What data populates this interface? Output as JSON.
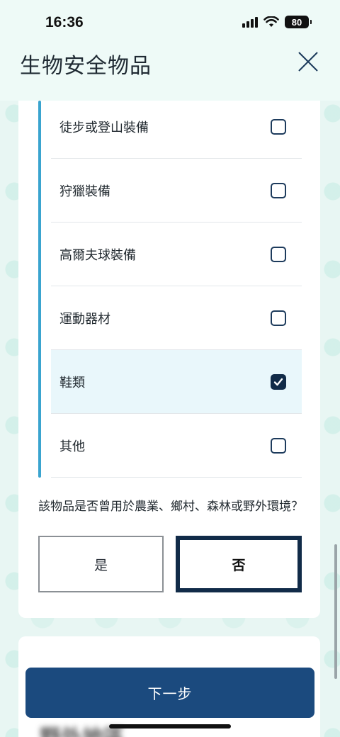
{
  "status_bar": {
    "time": "16:36",
    "battery": "80",
    "icons": [
      "signal-icon",
      "wifi-icon",
      "battery-icon"
    ]
  },
  "header": {
    "title": "生物安全物品",
    "close_icon": "close-icon"
  },
  "options": [
    {
      "label": "徒步或登山裝備",
      "checked": false
    },
    {
      "label": "狩獵裝備",
      "checked": false
    },
    {
      "label": "高爾夫球裝備",
      "checked": false
    },
    {
      "label": "運動器材",
      "checked": false
    },
    {
      "label": "鞋類",
      "checked": true
    },
    {
      "label": "其他",
      "checked": false
    }
  ],
  "question": {
    "text": "該物品是否曾用於農業、鄉村、森林或野外環境？",
    "yes_label": "是",
    "no_label": "否",
    "selected": "否"
  },
  "footer": {
    "next_label": "下一步",
    "blurred_heading": "野外地區"
  },
  "colors": {
    "accent": "#3aa4cf",
    "primary": "#1b4a7e",
    "selected_bg": "#e9f7fb",
    "background": "#e8f6f3"
  }
}
